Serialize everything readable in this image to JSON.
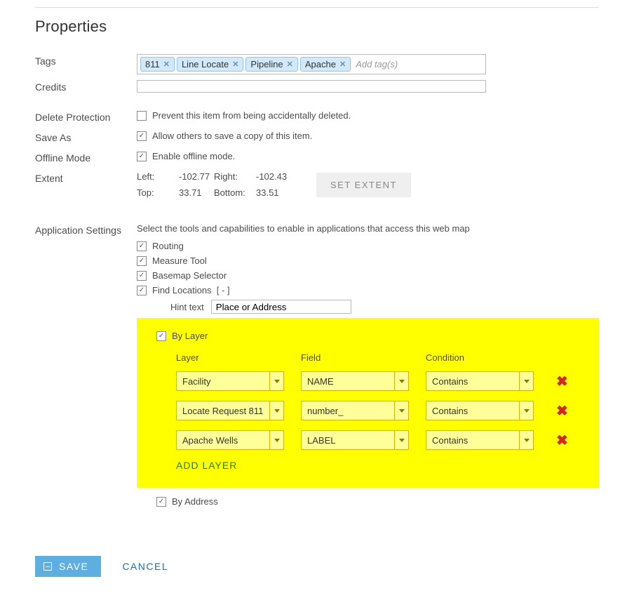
{
  "section_title": "Properties",
  "labels": {
    "tags": "Tags",
    "credits": "Credits",
    "delete_protection": "Delete Protection",
    "save_as": "Save As",
    "offline_mode": "Offline Mode",
    "extent": "Extent",
    "application_settings": "Application Settings"
  },
  "tags": {
    "items": [
      "811",
      "Line Locate",
      "Pipeline",
      "Apache"
    ],
    "placeholder": "Add tag(s)"
  },
  "delete_protection": {
    "label": "Prevent this item from being accidentally deleted.",
    "checked": false
  },
  "save_as": {
    "label": "Allow others to save a copy of this item.",
    "checked": true
  },
  "offline_mode": {
    "label": "Enable offline mode.",
    "checked": true
  },
  "extent": {
    "left_label": "Left:",
    "left": "-102.77",
    "right_label": "Right:",
    "right": "-102.43",
    "top_label": "Top:",
    "top": "33.71",
    "bottom_label": "Bottom:",
    "bottom": "33.51",
    "button": "SET EXTENT"
  },
  "appsettings": {
    "intro": "Select the tools and capabilities to enable in applications that access this web map",
    "routing": {
      "label": "Routing",
      "checked": true
    },
    "measure": {
      "label": "Measure Tool",
      "checked": true
    },
    "basemap": {
      "label": "Basemap Selector",
      "checked": true
    },
    "find_locations": {
      "label": "Find Locations",
      "checked": true,
      "collapse": "[ - ]"
    },
    "hint_label": "Hint text",
    "hint_value": "Place or Address",
    "by_layer": {
      "label": "By Layer",
      "checked": true,
      "head_layer": "Layer",
      "head_field": "Field",
      "head_condition": "Condition",
      "rows": [
        {
          "layer": "Facility",
          "field": "NAME",
          "condition": "Contains"
        },
        {
          "layer": "Locate Request 811",
          "field": "number_",
          "condition": "Contains"
        },
        {
          "layer": "Apache Wells",
          "field": "LABEL",
          "condition": "Contains"
        }
      ],
      "add_layer": "ADD LAYER"
    },
    "by_address": {
      "label": "By Address",
      "checked": true
    }
  },
  "footer": {
    "save": "SAVE",
    "cancel": "CANCEL"
  }
}
